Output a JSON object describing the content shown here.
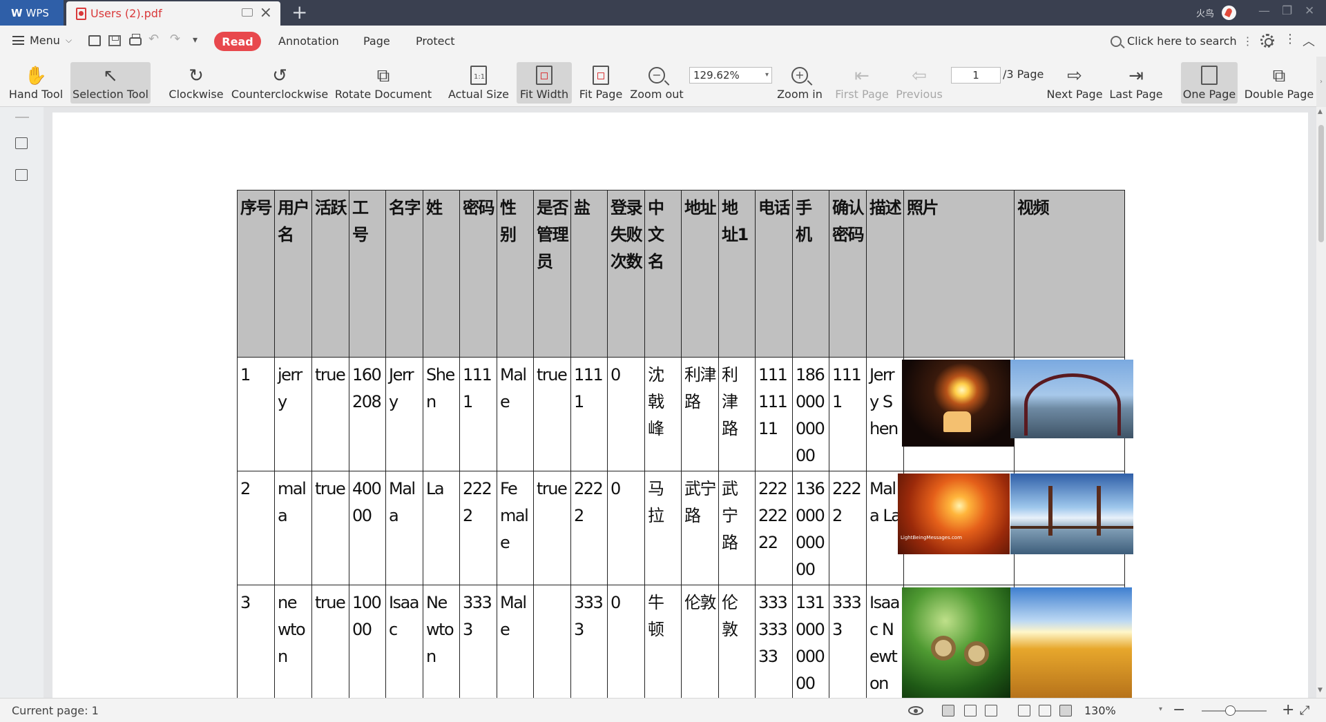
{
  "titlebar": {
    "app_name": "WPS",
    "doc_tab": "Users (2).pdf",
    "user_name": "火鸟"
  },
  "menubar": {
    "menu_label": "Menu",
    "read_label": "Read",
    "items": [
      "Annotation",
      "Page",
      "Protect"
    ],
    "search_placeholder": "Click here to search"
  },
  "ribbon": {
    "tools": {
      "hand": "Hand Tool",
      "selection": "Selection Tool",
      "clockwise": "Clockwise",
      "counterclockwise": "Counterclockwise",
      "rotate_document": "Rotate Document",
      "actual_size": "Actual Size",
      "fit_width": "Fit Width",
      "fit_page": "Fit Page",
      "zoom_out": "Zoom out",
      "zoom_in": "Zoom in",
      "first_page": "First Page",
      "previous": "Previous",
      "next_page": "Next Page",
      "last_page": "Last Page",
      "one_page": "One Page",
      "double_page": "Double Page"
    },
    "zoom_value": "129.62%",
    "page_value": "1",
    "page_total": "/3 Page",
    "actual_size_glyph": "1:1"
  },
  "table": {
    "headers": [
      "序号",
      "用户名",
      "活跃",
      "工号",
      "名字",
      "姓",
      "密码",
      "性别",
      "是否管理员",
      "盐",
      "登录失败次数",
      "中文名",
      "地址",
      "地址1",
      "电话",
      "手机",
      "确认密码",
      "描述",
      "照片",
      "视频"
    ],
    "rows": [
      [
        "1",
        "jerry",
        "true",
        "160208",
        "Jerry",
        "Shen",
        "1111",
        "Male",
        "true",
        "1111",
        "0",
        "沈戟峰",
        "利津路",
        "利津路",
        "11111111",
        "18600000000",
        "1111",
        "Jerry Shen"
      ],
      [
        "2",
        "mala",
        "true",
        "40000",
        "Mala",
        "La",
        "2222",
        "Female",
        "true",
        "2222",
        "0",
        "马拉",
        "武宁路",
        "武宁路",
        "22222222",
        "13600000000",
        "2222",
        "Mala La"
      ],
      [
        "3",
        "newton",
        "true",
        "10000",
        "Isaac",
        "Newton",
        "3333",
        "Male",
        "",
        "3333",
        "0",
        "牛顿",
        "伦敦",
        "伦敦",
        "33333333",
        "13100000000",
        "3333",
        "Isaac Newton"
      ]
    ],
    "photo_caption": "LightBeingMessages.com"
  },
  "statusbar": {
    "current_page": "Current page: 1",
    "zoom_percent": "130%"
  }
}
